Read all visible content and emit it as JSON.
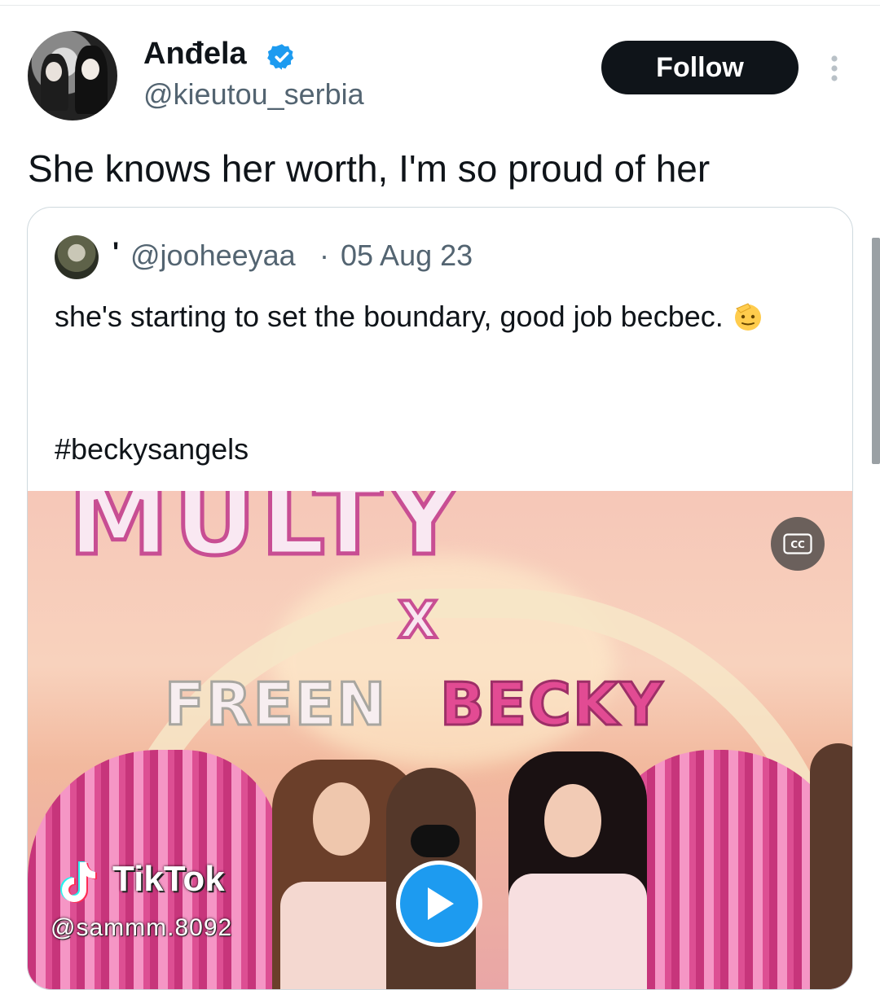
{
  "author": {
    "display_name": "Anđela",
    "handle": "@kieutou_serbia",
    "verified": true
  },
  "follow_button": {
    "label": "Follow"
  },
  "tweet": {
    "text": "She knows her worth, I'm so proud of her"
  },
  "quoted_tweet": {
    "display_name": "'",
    "handle": "@jooheeyaa",
    "separator": "·",
    "date": "05 Aug 23",
    "text": "she's starting to set the boundary, good job becbec.",
    "emoji": "saluting-face-emoji",
    "hashtag": "#beckysangels"
  },
  "media": {
    "banner_top": "MULTY",
    "banner_x": "X",
    "banner_freen": "FREEN",
    "banner_becky": "BECKY",
    "watermark_brand": "TikTok",
    "watermark_user": "@sammm.8092",
    "cc_label": "CC",
    "is_video": true
  },
  "colors": {
    "accent": "#1d9bf0",
    "text_primary": "#0f1419",
    "text_secondary": "#536471",
    "border": "#cfd9de"
  }
}
